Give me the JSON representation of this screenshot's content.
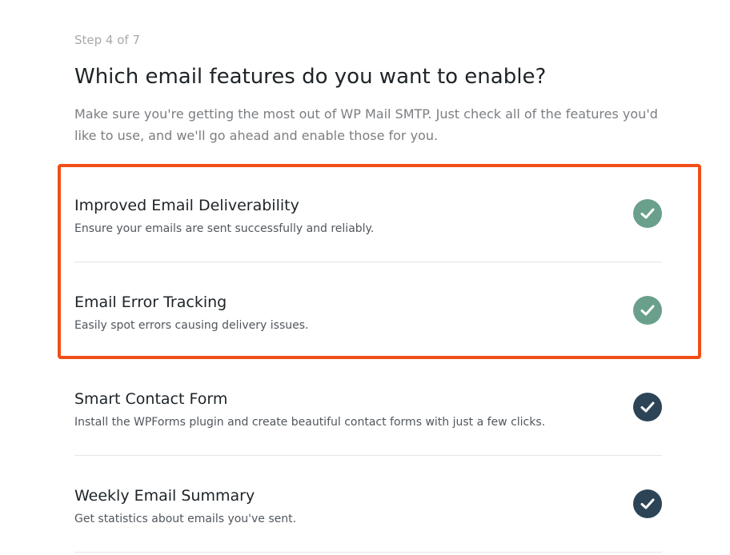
{
  "wizard": {
    "step_label": "Step 4 of 7",
    "title": "Which email features do you want to enable?",
    "description": "Make sure you're getting the most out of WP Mail SMTP. Just check all of the features you'd like to use, and we'll go ahead and enable those for you."
  },
  "colors": {
    "highlight_border": "#f04e16",
    "check_enabled_locked": "#6aa08b",
    "check_enabled": "#2c4456"
  },
  "features": [
    {
      "title": "Improved Email Deliverability",
      "description": "Ensure your emails are sent successfully and reliably.",
      "checked": true,
      "icon": "check-circle-icon"
    },
    {
      "title": "Email Error Tracking",
      "description": "Easily spot errors causing delivery issues.",
      "checked": true,
      "icon": "check-circle-icon"
    },
    {
      "title": "Smart Contact Form",
      "description": "Install the WPForms plugin and create beautiful contact forms with just a few clicks.",
      "checked": true,
      "icon": "check-circle-icon"
    },
    {
      "title": "Weekly Email Summary",
      "description": "Get statistics about emails you've sent.",
      "checked": true,
      "icon": "check-circle-icon"
    }
  ]
}
